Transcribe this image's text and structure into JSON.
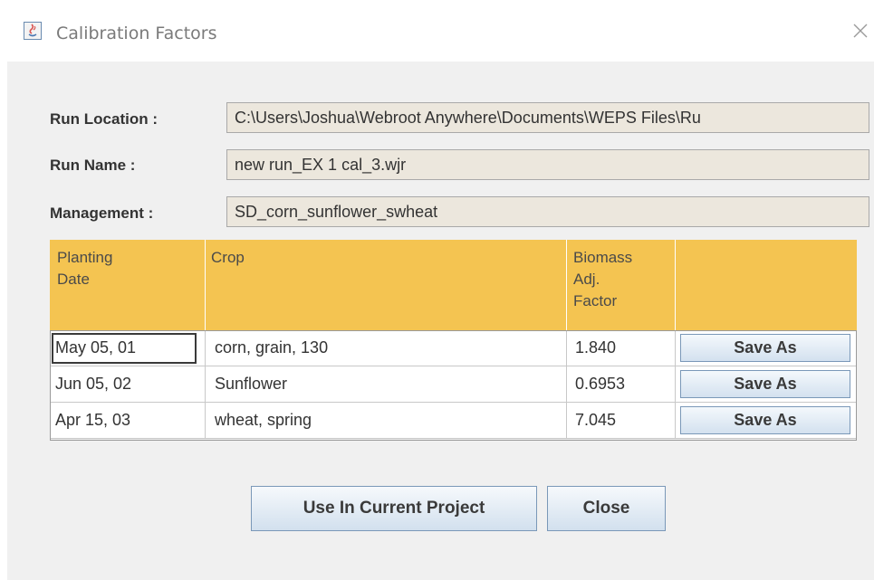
{
  "window": {
    "title": "Calibration Factors",
    "icon": "java-app-icon",
    "close_icon": "close-icon"
  },
  "fields": {
    "run_location": {
      "label": "Run Location :",
      "value": "C:\\Users\\Joshua\\Webroot Anywhere\\Documents\\WEPS Files\\Ru"
    },
    "run_name": {
      "label": "Run Name :",
      "value": "new run_EX 1 cal_3.wjr"
    },
    "management": {
      "label": "Management :",
      "value": "SD_corn_sunflower_swheat"
    }
  },
  "table": {
    "headers": {
      "planting_date": [
        "Planting",
        "Date"
      ],
      "crop": [
        "Crop"
      ],
      "biomass": [
        "Biomass",
        "Adj.",
        "Factor"
      ],
      "action": [
        ""
      ]
    },
    "rows": [
      {
        "date": "May 05, 01",
        "crop": "corn, grain, 130",
        "factor": "1.840",
        "action": "Save As"
      },
      {
        "date": "Jun 05, 02",
        "crop": "Sunflower",
        "factor": "0.6953",
        "action": "Save As"
      },
      {
        "date": "Apr 15, 03",
        "crop": "wheat, spring",
        "factor": "7.045",
        "action": "Save As"
      }
    ]
  },
  "buttons": {
    "use_in_project": "Use In Current Project",
    "close": "Close"
  },
  "colors": {
    "header_bg": "#f4c451",
    "field_bg": "#ece7dd",
    "panel_bg": "#f0f0f0"
  }
}
